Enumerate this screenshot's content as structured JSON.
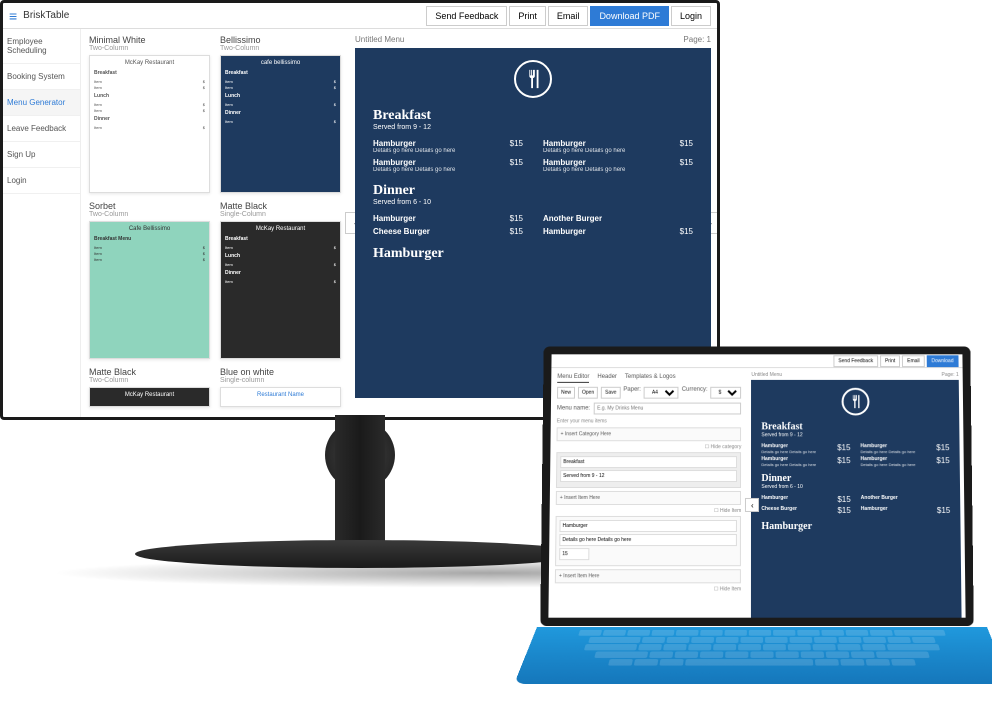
{
  "app_name": "BriskTable",
  "topbar": {
    "send_feedback": "Send Feedback",
    "print": "Print",
    "email": "Email",
    "download": "Download PDF",
    "login": "Login"
  },
  "sidebar": {
    "items": [
      {
        "label": "Employee Scheduling"
      },
      {
        "label": "Booking System"
      },
      {
        "label": "Menu Generator"
      },
      {
        "label": "Leave Feedback"
      },
      {
        "label": "Sign Up"
      },
      {
        "label": "Login"
      }
    ]
  },
  "templates": [
    {
      "title": "Minimal White",
      "sub": "Two-Column",
      "variant": "white",
      "head": "McKay Restaurant"
    },
    {
      "title": "Bellissimo",
      "sub": "Two-Column",
      "variant": "navy",
      "head": "cafe bellissimo"
    },
    {
      "title": "Sorbet",
      "sub": "Two-Column",
      "variant": "mint",
      "head": "Cafe Bellissimo"
    },
    {
      "title": "Matte Black",
      "sub": "Single-Column",
      "variant": "black",
      "head": "McKay Restaurant"
    },
    {
      "title": "Matte Black",
      "sub": "Two-Column",
      "variant": "black",
      "head": "McKay Restaurant"
    },
    {
      "title": "Blue on white",
      "sub": "Single-column",
      "variant": "white",
      "head": "Restaurant Name"
    }
  ],
  "tpl_sections": [
    "Breakfast",
    "Lunch",
    "Dinner"
  ],
  "preview": {
    "title": "Untitled Menu",
    "page_label": "Page:",
    "page_num": "1",
    "sections": [
      {
        "title": "Breakfast",
        "sub": "Served from 9 - 12",
        "items": [
          {
            "name": "Hamburger",
            "detail": "Details go here Details go here",
            "price": "$15"
          },
          {
            "name": "Hamburger",
            "detail": "Details go here Details go here",
            "price": "$15"
          },
          {
            "name": "Hamburger",
            "detail": "Details go here Details go here",
            "price": "$15"
          },
          {
            "name": "Hamburger",
            "detail": "Details go here Details go here",
            "price": "$15"
          }
        ]
      },
      {
        "title": "Dinner",
        "sub": "Served from 6 - 10",
        "items": [
          {
            "name": "Hamburger",
            "detail": "",
            "price": "$15"
          },
          {
            "name": "Another Burger",
            "detail": "",
            "price": ""
          },
          {
            "name": "Cheese Burger",
            "detail": "",
            "price": "$15"
          },
          {
            "name": "Hamburger",
            "detail": "",
            "price": "$15"
          }
        ]
      },
      {
        "title": "Hamburger",
        "sub": "",
        "items": []
      }
    ]
  },
  "laptop": {
    "topbar": {
      "send_feedback": "Send Feedback",
      "print": "Print",
      "email": "Email",
      "download": "Download"
    },
    "tabs": [
      "Menu Editor",
      "Header",
      "Templates & Logos"
    ],
    "toolbar": {
      "new": "New",
      "open": "Open",
      "save": "Save",
      "paper": "Paper:",
      "paper_val": "A4",
      "currency": "Currency:",
      "currency_val": "$"
    },
    "name_label": "Menu name:",
    "name_placeholder": "E.g. My Drinks Menu",
    "hint": "Enter your menu items",
    "insert_cat": "+ Insert Category Here",
    "hide_cat": "Hide category",
    "cat_name": "Breakfast",
    "cat_sub": "Served from 9 - 12",
    "insert_item": "+ Insert Item Here",
    "hide_item": "Hide Item",
    "item_name": "Hamburger",
    "item_detail": "Details go here Details go here",
    "item_price": "15",
    "insert_item2": "+ Insert Item Here",
    "hide_item2": "Hide Item"
  }
}
